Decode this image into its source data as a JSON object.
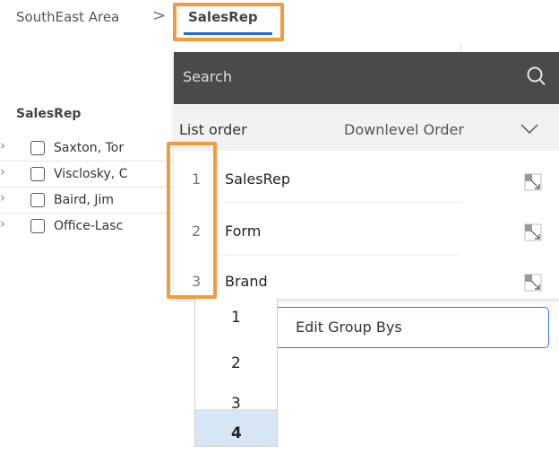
{
  "breadcrumb": {
    "parent": "SouthEast Area",
    "separator": ">",
    "current": "SalesRep"
  },
  "list": {
    "column_label": "SalesRep",
    "rows": [
      {
        "name": "Saxton, Tor"
      },
      {
        "name": "Visclosky, C"
      },
      {
        "name": "Baird, Jim"
      },
      {
        "name": "Office-Lasc"
      }
    ]
  },
  "panel": {
    "search_placeholder": "Search",
    "order_label": "List order",
    "order_value": "Downlevel Order",
    "items": [
      {
        "num": "1",
        "label": "SalesRep"
      },
      {
        "num": "2",
        "label": "Form"
      },
      {
        "num": "3",
        "label": "Brand"
      }
    ],
    "edit_button_label": "Edit Group Bys"
  },
  "dropdown": {
    "options": [
      "1",
      "2",
      "3",
      "4"
    ],
    "selected": "4"
  },
  "colors": {
    "highlight": "#f39a3e",
    "accent": "#1f6fd1",
    "search_bar": "#4a4a4a",
    "selected_option": "#d7e6f4"
  },
  "icons": [
    "chevron-right-icon",
    "search-icon",
    "chevron-down-icon",
    "resize-icon"
  ]
}
